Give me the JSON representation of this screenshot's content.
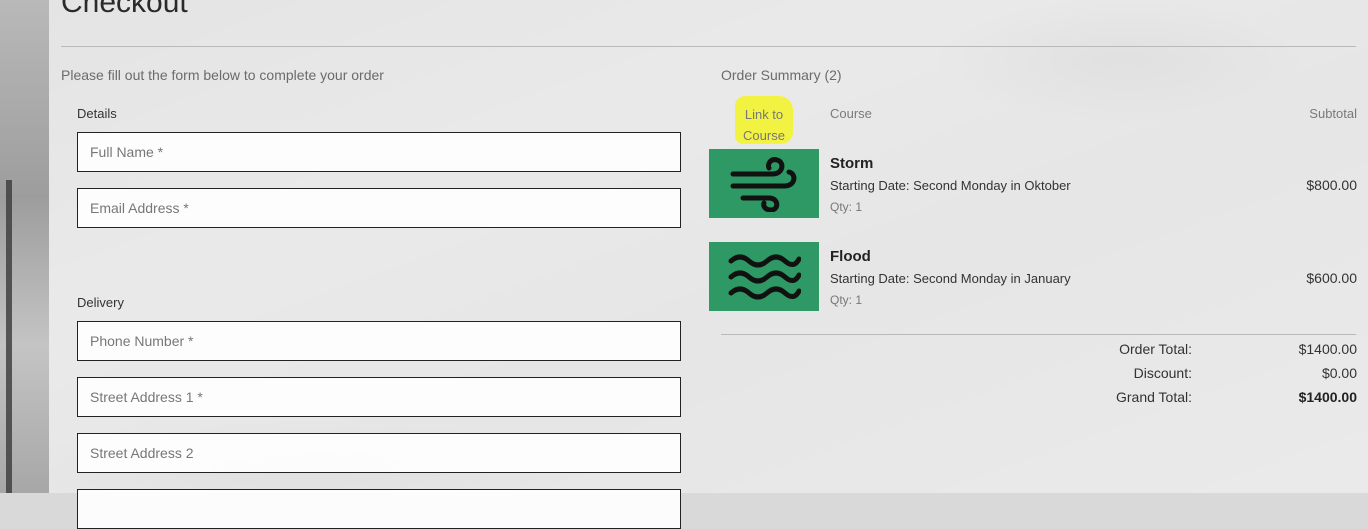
{
  "page": {
    "title": "Checkout",
    "intro": "Please fill out the form below to complete your order"
  },
  "form": {
    "details_label": "Details",
    "full_name_placeholder": "Full Name *",
    "email_placeholder": "Email Address *",
    "delivery_label": "Delivery",
    "phone_placeholder": "Phone Number *",
    "street1_placeholder": "Street Address 1 *",
    "street2_placeholder": "Street Address 2"
  },
  "summary": {
    "title": "Order Summary (2)",
    "columns": {
      "link": "Link to Course",
      "course": "Course",
      "subtotal": "Subtotal"
    },
    "items": [
      {
        "name": "Storm",
        "date": "Starting Date: Second Monday in Oktober",
        "qty": "Qty: 1",
        "subtotal": "$800.00",
        "icon": "wind-icon"
      },
      {
        "name": "Flood",
        "date": "Starting Date: Second Monday in January",
        "qty": "Qty: 1",
        "subtotal": "$600.00",
        "icon": "waves-icon"
      }
    ],
    "totals": {
      "order_total_label": "Order Total:",
      "order_total": "$1400.00",
      "discount_label": "Discount:",
      "discount": "$0.00",
      "grand_total_label": "Grand Total:",
      "grand_total": "$1400.00"
    }
  },
  "colors": {
    "thumbnail": "#2e9965",
    "highlight": "#f2f23a"
  }
}
